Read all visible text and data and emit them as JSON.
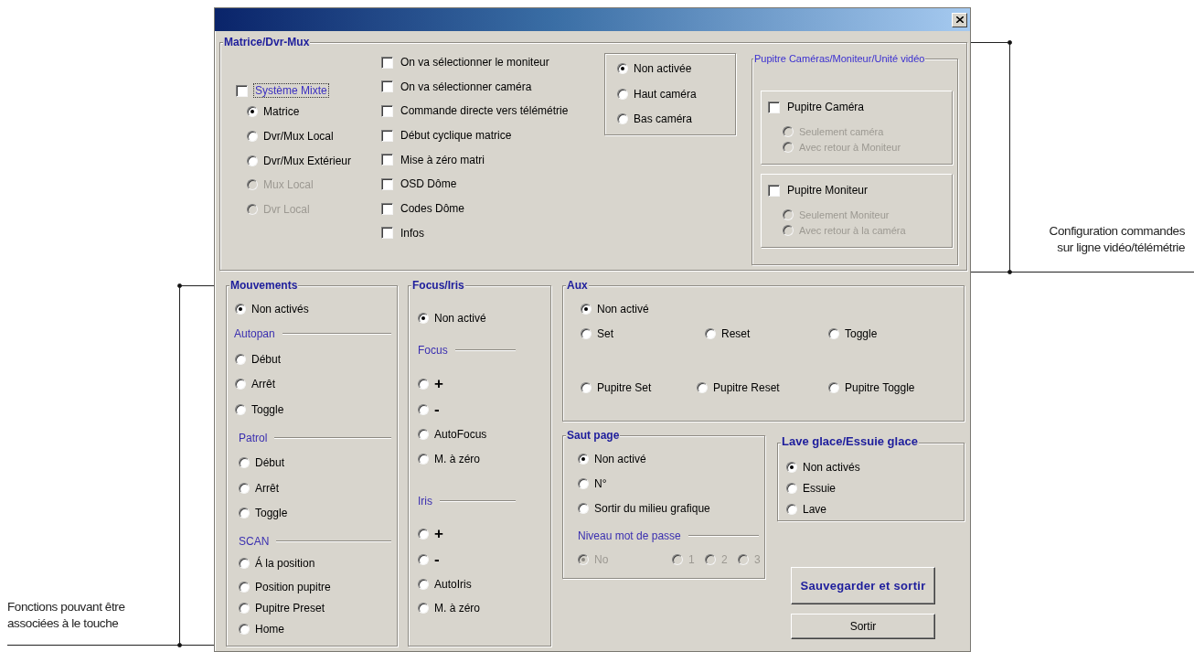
{
  "matrice_dvr_mux": {
    "title": "Matrice/Dvr-Mux",
    "systeme_mixte": {
      "label": "Système Mixte",
      "checked": false,
      "focused": true
    },
    "modes": [
      {
        "label": "Matrice",
        "selected": true,
        "disabled": false
      },
      {
        "label": "Dvr/Mux Local",
        "selected": false,
        "disabled": false
      },
      {
        "label": "Dvr/Mux Extérieur",
        "selected": false,
        "disabled": false
      },
      {
        "label": "Mux Local",
        "selected": false,
        "disabled": true
      },
      {
        "label": "Dvr Local",
        "selected": false,
        "disabled": true
      }
    ],
    "options": [
      {
        "label": "On va sélectionner le moniteur",
        "checked": false
      },
      {
        "label": "On va sélectionner caméra",
        "checked": false
      },
      {
        "label": "Commande directe vers télémétrie",
        "checked": false
      },
      {
        "label": "Début cyclique matrice",
        "checked": false
      },
      {
        "label": "Mise à zéro matri",
        "checked": false
      },
      {
        "label": "OSD Dôme",
        "checked": false
      },
      {
        "label": "Codes Dôme",
        "checked": false
      },
      {
        "label": "Infos",
        "checked": false
      }
    ],
    "camera_position": [
      {
        "label": "Non activée",
        "selected": true
      },
      {
        "label": "Haut caméra",
        "selected": false
      },
      {
        "label": "Bas caméra",
        "selected": false
      }
    ],
    "pupitre": {
      "title": "Pupitre Caméras/Moniteur/Unité vidéo",
      "panels": [
        {
          "label": "Pupitre Caméra",
          "checked": false,
          "options": [
            {
              "label": "Seulement caméra",
              "selected": false,
              "disabled": true
            },
            {
              "label": "Avec retour à Moniteur",
              "selected": false,
              "disabled": true
            }
          ]
        },
        {
          "label": "Pupitre Moniteur",
          "checked": false,
          "options": [
            {
              "label": "Seulement Moniteur",
              "selected": false,
              "disabled": true
            },
            {
              "label": "Avec retour à la caméra",
              "selected": false,
              "disabled": true
            }
          ]
        }
      ]
    }
  },
  "mouvements": {
    "title": "Mouvements",
    "items": [
      {
        "kind": "radio",
        "label": "Non activés",
        "selected": true
      },
      {
        "kind": "heading",
        "label": "Autopan"
      },
      {
        "kind": "radio",
        "label": "Début",
        "selected": false
      },
      {
        "kind": "radio",
        "label": "Arrêt",
        "selected": false
      },
      {
        "kind": "radio",
        "label": "Toggle",
        "selected": false
      },
      {
        "kind": "heading",
        "label": "Patrol"
      },
      {
        "kind": "radio",
        "label": "Début",
        "selected": false
      },
      {
        "kind": "radio",
        "label": "Arrêt",
        "selected": false
      },
      {
        "kind": "radio",
        "label": "Toggle",
        "selected": false
      },
      {
        "kind": "heading",
        "label": "SCAN"
      },
      {
        "kind": "radio",
        "label": "Á la position",
        "selected": false
      },
      {
        "kind": "radio",
        "label": "Position pupitre",
        "selected": false
      },
      {
        "kind": "radio",
        "label": "Pupitre Preset",
        "selected": false
      },
      {
        "kind": "radio",
        "label": "Home",
        "selected": false
      }
    ]
  },
  "focus_iris": {
    "title": "Focus/Iris",
    "items": [
      {
        "kind": "radio",
        "label": "Non activé",
        "selected": true
      },
      {
        "kind": "heading",
        "label": "Focus"
      },
      {
        "kind": "symbol-radio",
        "label": "+",
        "selected": false
      },
      {
        "kind": "symbol-radio",
        "label": "-",
        "selected": false
      },
      {
        "kind": "radio",
        "label": "AutoFocus",
        "selected": false
      },
      {
        "kind": "radio",
        "label": "M. à zéro",
        "selected": false
      },
      {
        "kind": "heading",
        "label": "Iris"
      },
      {
        "kind": "symbol-radio",
        "label": "+",
        "selected": false
      },
      {
        "kind": "symbol-radio",
        "label": "-",
        "selected": false
      },
      {
        "kind": "radio",
        "label": "AutoIris",
        "selected": false
      },
      {
        "kind": "radio",
        "label": "M. à zéro",
        "selected": false
      }
    ]
  },
  "aux": {
    "title": "Aux",
    "options": [
      {
        "label": "Non activé",
        "selected": true
      },
      {
        "label": "Set",
        "selected": false
      },
      {
        "label": "Reset",
        "selected": false
      },
      {
        "label": "Toggle",
        "selected": false
      },
      {
        "label": "Pupitre Set",
        "selected": false
      },
      {
        "label": "Pupitre Reset",
        "selected": false
      },
      {
        "label": "Pupitre Toggle",
        "selected": false
      }
    ]
  },
  "saut_page": {
    "title": "Saut page",
    "options": [
      {
        "label": "Non activé",
        "selected": true
      },
      {
        "label": "N°",
        "selected": false
      },
      {
        "label": "Sortir du milieu grafique",
        "selected": false
      }
    ],
    "password": {
      "label": "Niveau mot de passe",
      "levels": [
        {
          "label": "No",
          "selected": true,
          "disabled": true
        },
        {
          "label": "1",
          "selected": false,
          "disabled": true
        },
        {
          "label": "2",
          "selected": false,
          "disabled": true
        },
        {
          "label": "3",
          "selected": false,
          "disabled": true
        }
      ]
    }
  },
  "lave_glace": {
    "title": "Lave glace/Essuie glace",
    "options": [
      {
        "label": "Non activés",
        "selected": true
      },
      {
        "label": "Essuie",
        "selected": false
      },
      {
        "label": "Lave",
        "selected": false
      }
    ]
  },
  "buttons": [
    {
      "label": "Sauvegarder et sortir",
      "default": true
    },
    {
      "label": "Sortir",
      "default": false
    }
  ],
  "annotations": {
    "right": "Configuration commandes\nsur ligne vidéo/télémétrie",
    "left": "Fonctions pouvant être\nassociées à le touche"
  }
}
